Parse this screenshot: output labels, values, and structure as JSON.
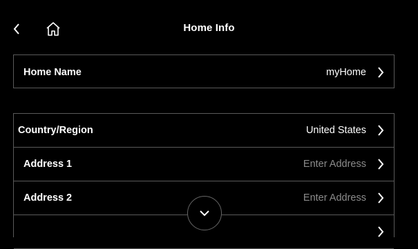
{
  "header": {
    "title": "Home Info",
    "back_icon": "chevron-left-icon",
    "home_icon": "home-icon"
  },
  "home_group": {
    "rows": [
      {
        "label": "Home Name",
        "value": "myHome",
        "placeholder": false
      }
    ]
  },
  "address_group": {
    "rows": [
      {
        "label": "Country/Region",
        "value": "United States",
        "placeholder": false
      },
      {
        "label": "Address 1",
        "value": "Enter Address",
        "placeholder": true
      },
      {
        "label": "Address 2",
        "value": "Enter Address",
        "placeholder": true
      }
    ]
  },
  "scroll_down_icon": "chevron-down-icon",
  "colors": {
    "background": "#000000",
    "text": "#ffffff",
    "placeholder": "#8b8b8b",
    "divider": "#5a5a5a"
  }
}
